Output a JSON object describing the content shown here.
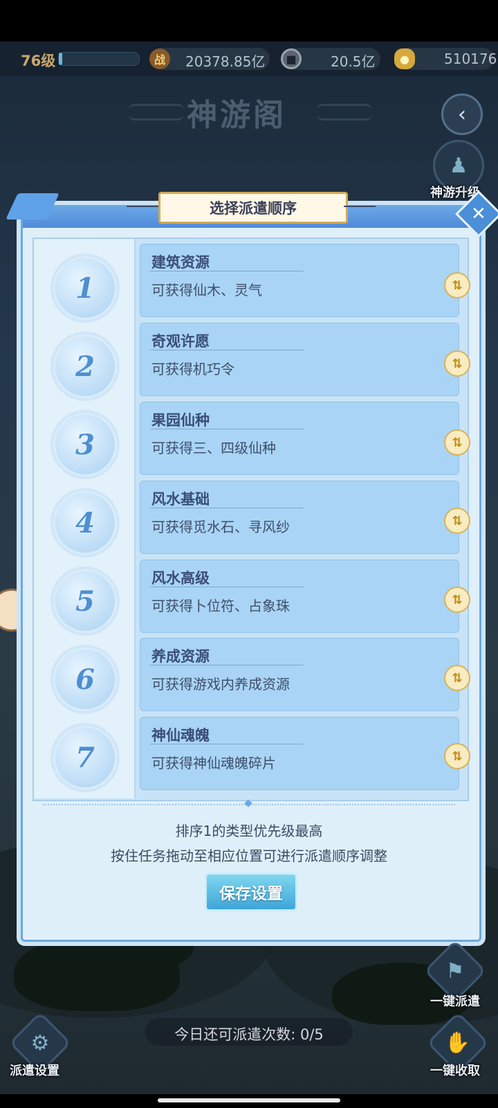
{
  "resources": {
    "level": "76级",
    "xp_fraction": 0.04,
    "power_icon": "战",
    "power_value": "20378.85亿",
    "coin_value": "20.5亿",
    "gold_value": "510176"
  },
  "page": {
    "title": "神游阁"
  },
  "side_buttons": {
    "upgrade_label": "神游升级",
    "dispatch_all_label": "一键派遣",
    "collect_all_label": "一键收取",
    "dispatch_settings_label": "派遣设置"
  },
  "modal": {
    "title": "选择派遣顺序",
    "items": [
      {
        "num": "1",
        "title": "建筑资源",
        "desc": "可获得仙木、灵气"
      },
      {
        "num": "2",
        "title": "奇观许愿",
        "desc": "可获得机巧令"
      },
      {
        "num": "3",
        "title": "果园仙种",
        "desc": "可获得三、四级仙种"
      },
      {
        "num": "4",
        "title": "风水基础",
        "desc": "可获得觅水石、寻风纱"
      },
      {
        "num": "5",
        "title": "风水高级",
        "desc": "可获得卜位符、占象珠"
      },
      {
        "num": "6",
        "title": "养成资源",
        "desc": "可获得游戏内养成资源"
      },
      {
        "num": "7",
        "title": "神仙魂魄",
        "desc": "可获得神仙魂魄碎片"
      }
    ],
    "hint_line1": "排序1的类型优先级最高",
    "hint_line2": "按住任务拖动至相应位置可进行派遣顺序调整",
    "save_label": "保存设置"
  },
  "footer": {
    "remaining_text": "今日还可派遣次数: 0/5"
  },
  "icons": {
    "back": "back-arrow-icon",
    "close": "close-icon",
    "sort": "sort-arrows-icon"
  }
}
